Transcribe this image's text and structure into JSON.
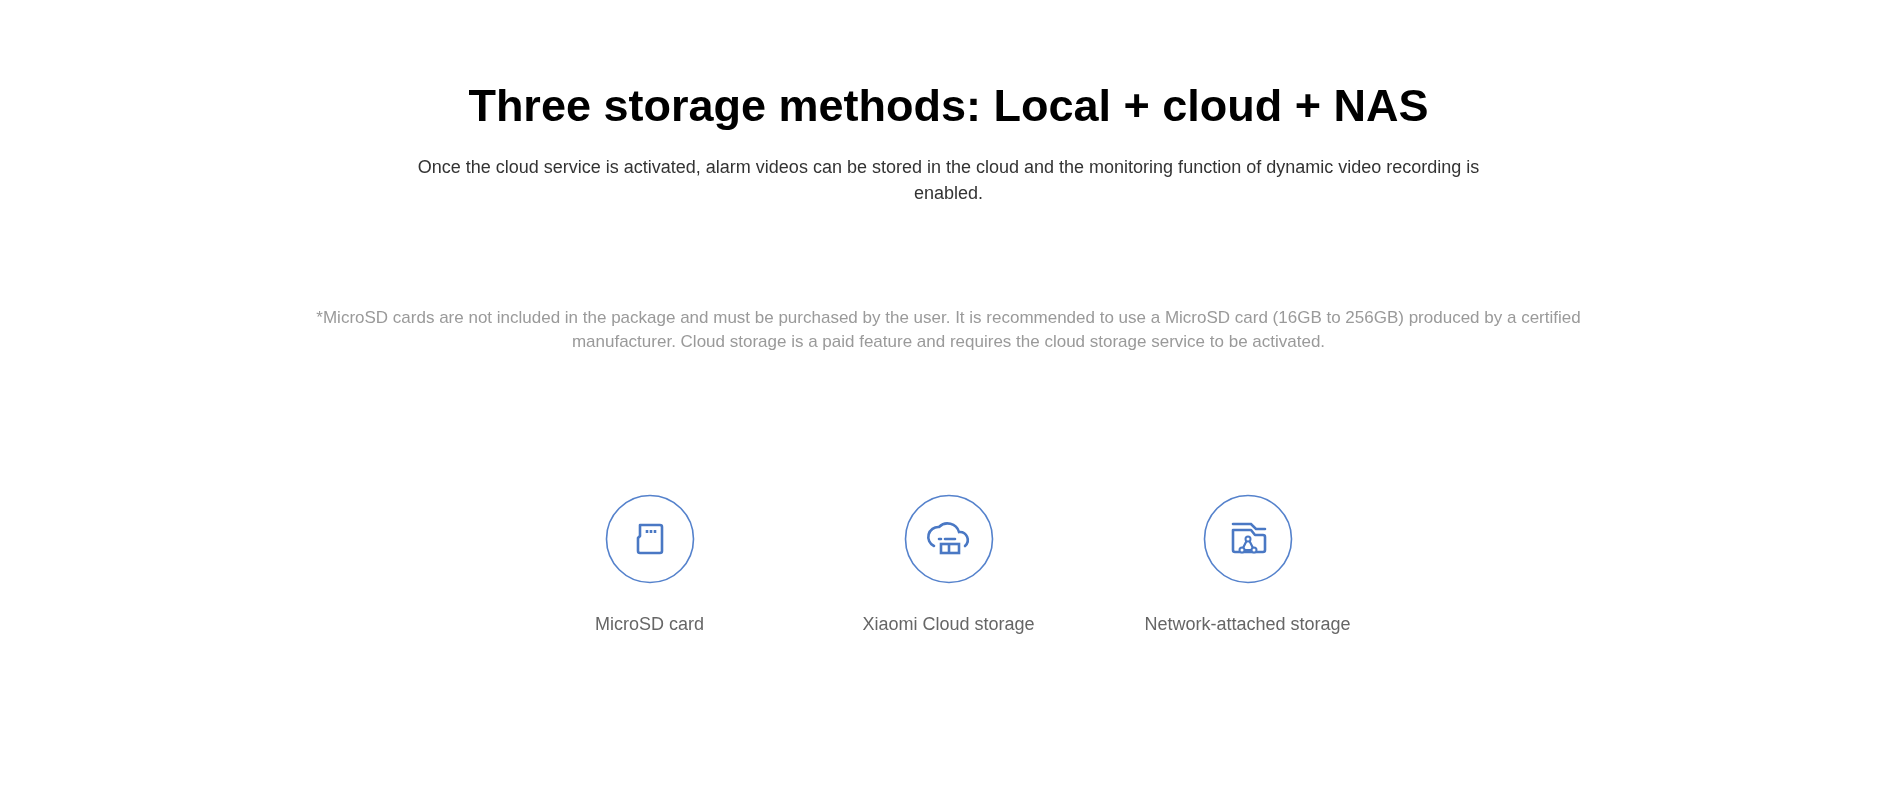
{
  "title": "Three storage methods: Local + cloud + NAS",
  "description": "Once the cloud service is activated, alarm videos can be stored in the cloud and the monitoring function of dynamic video recording is enabled.",
  "footnote": "*MicroSD cards are not included in the package and must be purchased by the user. It is recommended to use a MicroSD card (16GB to 256GB) produced by a certified manufacturer. Cloud storage is a paid feature and requires the cloud storage service to be activated.",
  "methods": [
    {
      "kind": "card",
      "label": "MicroSD card"
    },
    {
      "kind": "cloud",
      "label": "Xiaomi Cloud storage"
    },
    {
      "kind": "nas",
      "label": "Network-attached storage"
    }
  ]
}
